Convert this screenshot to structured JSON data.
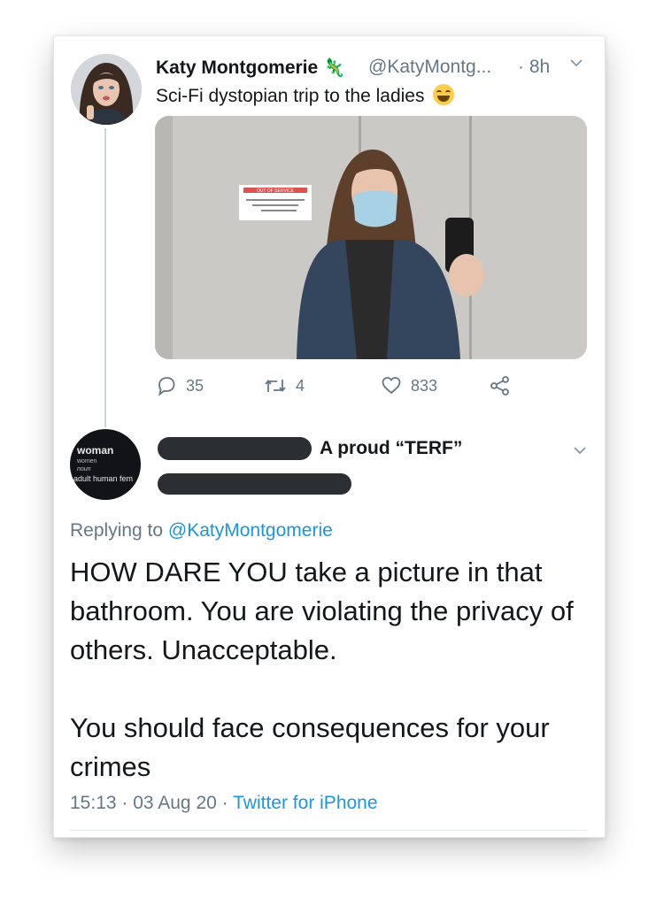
{
  "tweet": {
    "author_name": "Katy Montgomerie",
    "handle": "@KatyMontg...",
    "time_sep": "·",
    "time": "8h",
    "text": "Sci-Fi dystopian trip to the ladies",
    "emoji": "laughing-tears-emoji",
    "photo_sign_text": "OUT OF SERVICE",
    "actions": {
      "replies": "35",
      "retweets": "4",
      "likes": "833"
    }
  },
  "reply": {
    "avatar_text": {
      "title": "woman",
      "plural": "women",
      "pos": "noun",
      "definition": "adult human fem"
    },
    "display_name_suffix": "A proud “TERF”",
    "replying_prefix": "Replying to",
    "replying_handle": "@KatyMontgomerie",
    "body_line_1": "HOW DARE YOU take a picture in that bathroom. You are violating the privacy of others. Unacceptable.",
    "body_line_2": "You should face consequences for your crimes",
    "timestamp": "15:13 · 03 Aug 20",
    "meta_sep": "·",
    "client": "Twitter for iPhone"
  },
  "colors": {
    "link": "#1b95e0",
    "secondary_text": "#657786",
    "redaction": "#2b2f33"
  }
}
